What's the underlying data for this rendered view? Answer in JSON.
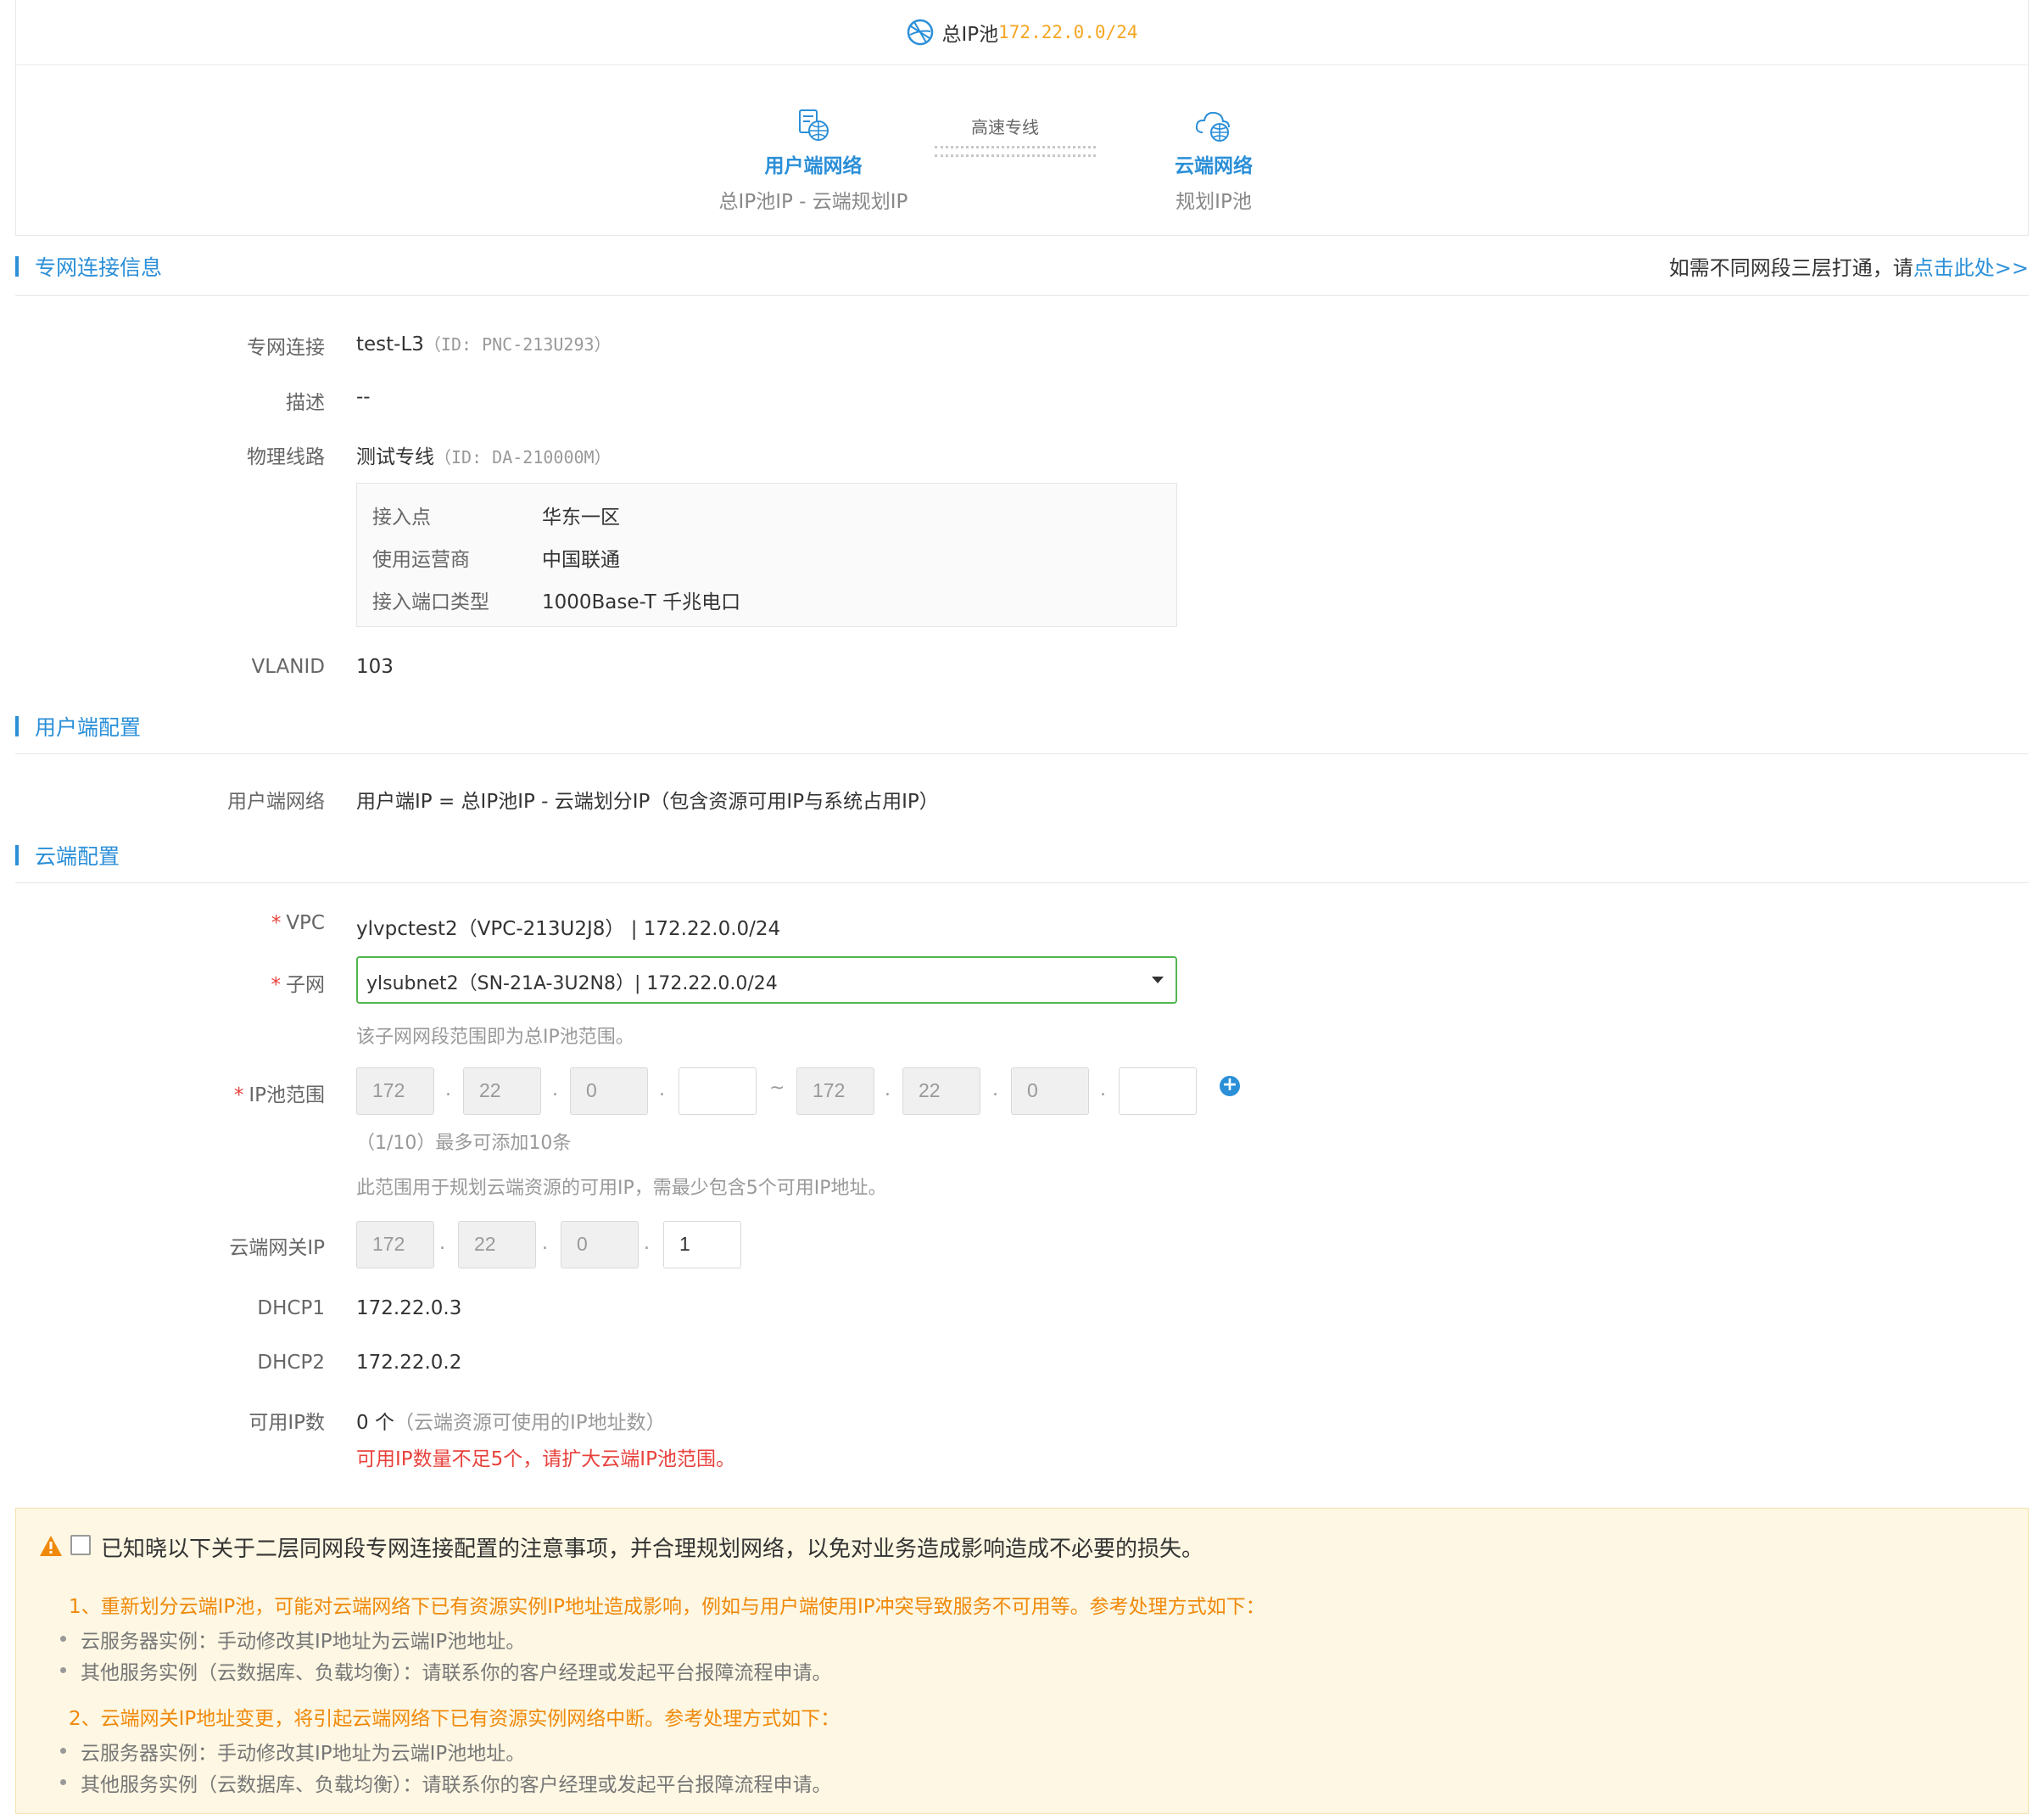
{
  "pool": {
    "label": "总IP池",
    "ip": "172.22.0.0/24",
    "user_node": {
      "title": "用户端网络",
      "sub": "总IP池IP - 云端规划IP"
    },
    "link_label": "高速专线",
    "cloud_node": {
      "title": "云端网络",
      "sub": "规划IP池"
    }
  },
  "sections": {
    "connection": "专网连接信息",
    "user_config": "用户端配置",
    "cloud_config": "云端配置"
  },
  "right_note": {
    "text": "如需不同网段三层打通，请",
    "link": "点击此处>>"
  },
  "connection": {
    "name_label": "专网连接",
    "name": "test-L3",
    "name_id": "（ID: PNC-213U293）",
    "desc_label": "描述",
    "desc": "--",
    "line_label": "物理线路",
    "line": "测试专线",
    "line_id": "（ID: DA-210000M）",
    "details": [
      {
        "k": "接入点",
        "v": "华东一区"
      },
      {
        "k": "使用运营商",
        "v": "中国联通"
      },
      {
        "k": "接入端口类型",
        "v": "1000Base-T 千兆电口"
      }
    ],
    "vlan_label": "VLANID",
    "vlan": "103"
  },
  "user_config": {
    "label": "用户端网络",
    "value": "用户端IP = 总IP池IP - 云端划分IP（包含资源可用IP与系统占用IP）"
  },
  "cloud_config": {
    "required_mark": "*",
    "vpc_label": "VPC",
    "vpc": "ylvpctest2（VPC-213U2J8）  | 172.22.0.0/24",
    "subnet_label": "子网",
    "subnet": "ylsubnet2（SN-21A-3U2N8）| 172.22.0.0/24",
    "subnet_hint": "该子网网段范围即为总IP池范围。",
    "pool_label": "IP池范围",
    "pool_start": [
      "172",
      "22",
      "0",
      ""
    ],
    "pool_end": [
      "172",
      "22",
      "0",
      ""
    ],
    "range_sep": "~",
    "octet_sep": ".",
    "add_icon": "plus-circle-icon",
    "pool_count_hint": "（1/10）最多可添加10条",
    "pool_usage_hint": "此范围用于规划云端资源的可用IP，需最少包含5个可用IP地址。",
    "gateway_label": "云端网关IP",
    "gateway": [
      "172",
      "22",
      "0",
      "1"
    ],
    "dhcp1_label": "DHCP1",
    "dhcp1": "172.22.0.3",
    "dhcp2_label": "DHCP2",
    "dhcp2": "172.22.0.2",
    "avail_label": "可用IP数",
    "avail_count": "0 个",
    "avail_note": "（云端资源可使用的IP地址数）",
    "avail_error": "可用IP数量不足5个，请扩大云端IP池范围。"
  },
  "notice": {
    "main": "已知晓以下关于二层同网段专网连接配置的注意事项，并合理规划网络，以免对业务造成影响造成不必要的损失。",
    "item1": "1、重新划分云端IP池，可能对云端网络下已有资源实例IP地址造成影响，例如与用户端使用IP冲突导致服务不可用等。参考处理方式如下：",
    "item1_b1": "云服务器实例：手动修改其IP地址为云端IP池地址。",
    "item1_b2": "其他服务实例（云数据库、负载均衡）：请联系你的客户经理或发起平台报障流程申请。",
    "item2": "2、云端网关IP地址变更，将引起云端网络下已有资源实例网络中断。参考处理方式如下：",
    "item2_b1": "云服务器实例：手动修改其IP地址为云端IP池地址。",
    "item2_b2": "其他服务实例（云数据库、负载均衡）：请联系你的客户经理或发起平台报障流程申请。"
  },
  "colors": {
    "accent": "#2b8fd8",
    "warning": "#f0890a",
    "error": "#e8413c",
    "ip_highlight": "#f5a623"
  }
}
